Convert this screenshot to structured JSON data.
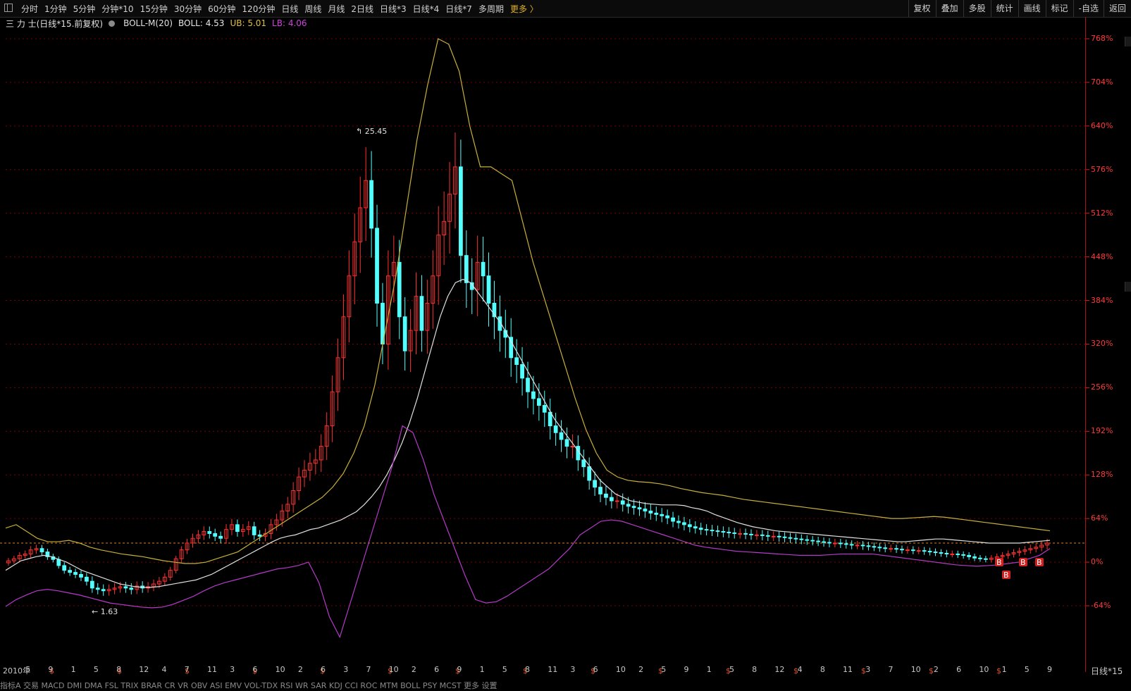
{
  "toolbar": {
    "periods": [
      "分时",
      "1分钟",
      "5分钟",
      "分钟*10",
      "15分钟",
      "30分钟",
      "60分钟",
      "120分钟",
      "日线",
      "周线",
      "月线",
      "2日线",
      "日线*3",
      "日线*4",
      "日线*7",
      "多周期"
    ],
    "more_label": "更多 〉",
    "tools": [
      "复权",
      "叠加",
      "多股",
      "统计",
      "画线",
      "标记",
      "-自选",
      "返回"
    ]
  },
  "infobar": {
    "stock_title": "三 力 士(日线*15.前复权)",
    "indicator": "BOLL-M(20)",
    "boll_label": "BOLL: 4.53",
    "ub_label": "UB: 5.01",
    "lb_label": "LB: 4.06"
  },
  "colors": {
    "up": "#ff3030",
    "down": "#54ffff",
    "mid": "#e0e0e0",
    "upper": "#c9b03a",
    "lower": "#b53ac9",
    "grid": "#7a0000",
    "axis": "#d02020"
  },
  "price_axis": [
    "768%",
    "704%",
    "640%",
    "576%",
    "512%",
    "448%",
    "384%",
    "320%",
    "256%",
    "192%",
    "128%",
    "64%",
    "0%",
    "-64%"
  ],
  "annotations": {
    "high_label": "25.45",
    "low_label": "1.63"
  },
  "time_axis": [
    "2010年",
    "5",
    "9",
    "1",
    "5",
    "8",
    "12",
    "4",
    "7",
    "11",
    "3",
    "6",
    "10",
    "2",
    "6",
    "3",
    "7",
    "10",
    "2",
    "6",
    "9",
    "1",
    "5",
    "8",
    "11",
    "3",
    "6",
    "10",
    "2",
    "5",
    "9",
    "1",
    "5",
    "8",
    "12",
    "4",
    "8",
    "11",
    "3",
    "7",
    "10",
    "2",
    "6",
    "10",
    "1",
    "5",
    "9"
  ],
  "period_label": "日线*15",
  "bottom_tabs": "指标A  交易  MACD  DMI  DMA  FSL  TRIX  BRAR  CR  VR  OBV  ASI  EMV  VOL-TDX  RSI  WR  SAR  KDJ  CCI  ROC  MTM  BOLL  PSY  MCST  更多  设置",
  "signal_markers": [
    "B",
    "B",
    "B",
    "B"
  ],
  "chart_data": {
    "type": "candlestick",
    "ylabel": "",
    "ylim": [
      -64,
      768
    ],
    "x_ticks_months": [
      "2010年",
      "5",
      "9",
      "1",
      "5",
      "8",
      "12",
      "4",
      "7",
      "11",
      "3",
      "6",
      "10",
      "2",
      "6",
      "3",
      "7",
      "10",
      "2",
      "6",
      "9",
      "1",
      "5",
      "8",
      "11",
      "3",
      "6",
      "10",
      "2",
      "5",
      "9",
      "1",
      "5",
      "8",
      "12",
      "4",
      "8",
      "11",
      "3",
      "7",
      "10",
      "2",
      "6",
      "10",
      "1",
      "5",
      "9"
    ],
    "close_pct": [
      2,
      5,
      10,
      12,
      18,
      20,
      15,
      8,
      4,
      -5,
      -12,
      -15,
      -18,
      -22,
      -28,
      -38,
      -40,
      -42,
      -40,
      -38,
      -36,
      -38,
      -40,
      -35,
      -38,
      -36,
      -32,
      -28,
      -22,
      -12,
      5,
      18,
      28,
      35,
      40,
      45,
      42,
      38,
      35,
      48,
      55,
      45,
      48,
      52,
      40,
      38,
      42,
      55,
      62,
      75,
      85,
      105,
      125,
      135,
      145,
      150,
      170,
      200,
      250,
      300,
      360,
      420,
      470,
      520,
      560,
      490,
      380,
      320,
      420,
      440,
      360,
      310,
      340,
      390,
      340,
      380,
      420,
      480,
      500,
      540,
      580,
      450,
      410,
      400,
      440,
      420,
      380,
      360,
      340,
      330,
      300,
      290,
      270,
      250,
      240,
      230,
      220,
      200,
      190,
      180,
      170,
      170,
      150,
      140,
      120,
      110,
      100,
      95,
      90,
      90,
      85,
      82,
      80,
      78,
      75,
      72,
      70,
      68,
      65,
      60,
      58,
      55,
      52,
      50,
      48,
      47,
      46,
      45,
      44,
      43,
      42,
      42,
      41,
      40,
      40,
      39,
      38,
      38,
      37,
      36,
      35,
      34,
      33,
      32,
      31,
      30,
      29,
      28,
      28,
      27,
      26,
      25,
      25,
      24,
      23,
      22,
      21,
      20,
      20,
      19,
      18,
      18,
      17,
      17,
      16,
      15,
      14,
      13,
      12,
      12,
      11,
      10,
      8,
      6,
      5,
      4,
      6,
      8,
      10,
      12,
      14,
      16,
      18,
      20,
      22,
      25,
      28
    ],
    "boll_mid_pct": [
      -12,
      -5,
      2,
      5,
      8,
      10,
      8,
      4,
      0,
      -6,
      -12,
      -16,
      -20,
      -24,
      -28,
      -32,
      -34,
      -36,
      -37,
      -37,
      -36,
      -34,
      -32,
      -30,
      -28,
      -26,
      -22,
      -18,
      -12,
      -6,
      0,
      6,
      12,
      18,
      24,
      30,
      35,
      38,
      40,
      44,
      48,
      50,
      54,
      58,
      62,
      68,
      74,
      84,
      96,
      110,
      128,
      150,
      175,
      205,
      240,
      280,
      320,
      360,
      390,
      410,
      415,
      410,
      395,
      380,
      365,
      350,
      330,
      310,
      290,
      270,
      250,
      230,
      210,
      195,
      180,
      165,
      150,
      135,
      120,
      110,
      100,
      95,
      90,
      88,
      86,
      85,
      84,
      84,
      84,
      83,
      80,
      78,
      75,
      70,
      66,
      62,
      58,
      55,
      52,
      50,
      48,
      46,
      45,
      44,
      43,
      42,
      41,
      40,
      39,
      38,
      37,
      36,
      35,
      34,
      33,
      32,
      31,
      30,
      30,
      31,
      32,
      33,
      34,
      34,
      33,
      32,
      31,
      30,
      29,
      28,
      28,
      28,
      28,
      28,
      29,
      30,
      31,
      32
    ],
    "boll_upper_pct": [
      50,
      55,
      45,
      35,
      30,
      30,
      32,
      28,
      22,
      18,
      15,
      12,
      10,
      8,
      5,
      2,
      0,
      -2,
      -2,
      0,
      5,
      10,
      15,
      25,
      35,
      45,
      55,
      65,
      75,
      85,
      95,
      110,
      130,
      160,
      200,
      260,
      340,
      420,
      520,
      620,
      700,
      768,
      760,
      720,
      640,
      580,
      580,
      570,
      560,
      500,
      440,
      390,
      340,
      290,
      240,
      195,
      160,
      135,
      125,
      120,
      118,
      117,
      115,
      112,
      108,
      105,
      102,
      100,
      98,
      95,
      92,
      90,
      88,
      86,
      84,
      82,
      80,
      78,
      76,
      74,
      72,
      70,
      68,
      66,
      64,
      64,
      65,
      66,
      67,
      66,
      64,
      62,
      60,
      58,
      56,
      54,
      52,
      50,
      48,
      46
    ],
    "boll_lower_pct": [
      -65,
      -55,
      -48,
      -42,
      -40,
      -42,
      -45,
      -48,
      -52,
      -56,
      -60,
      -62,
      -64,
      -66,
      -67,
      -66,
      -62,
      -56,
      -50,
      -42,
      -35,
      -30,
      -26,
      -22,
      -18,
      -14,
      -10,
      -8,
      -5,
      0,
      -30,
      -80,
      -110,
      -60,
      -10,
      40,
      90,
      140,
      200,
      190,
      150,
      100,
      60,
      20,
      -20,
      -55,
      -60,
      -58,
      -50,
      -40,
      -30,
      -20,
      -10,
      5,
      20,
      40,
      50,
      60,
      62,
      60,
      55,
      50,
      45,
      40,
      35,
      30,
      25,
      22,
      20,
      18,
      16,
      15,
      14,
      13,
      12,
      11,
      10,
      10,
      10,
      11,
      12,
      12,
      12,
      12,
      10,
      8,
      6,
      4,
      2,
      0,
      -2,
      -4,
      -5,
      -6,
      -5,
      -4,
      -2,
      0,
      5,
      10,
      20
    ]
  }
}
